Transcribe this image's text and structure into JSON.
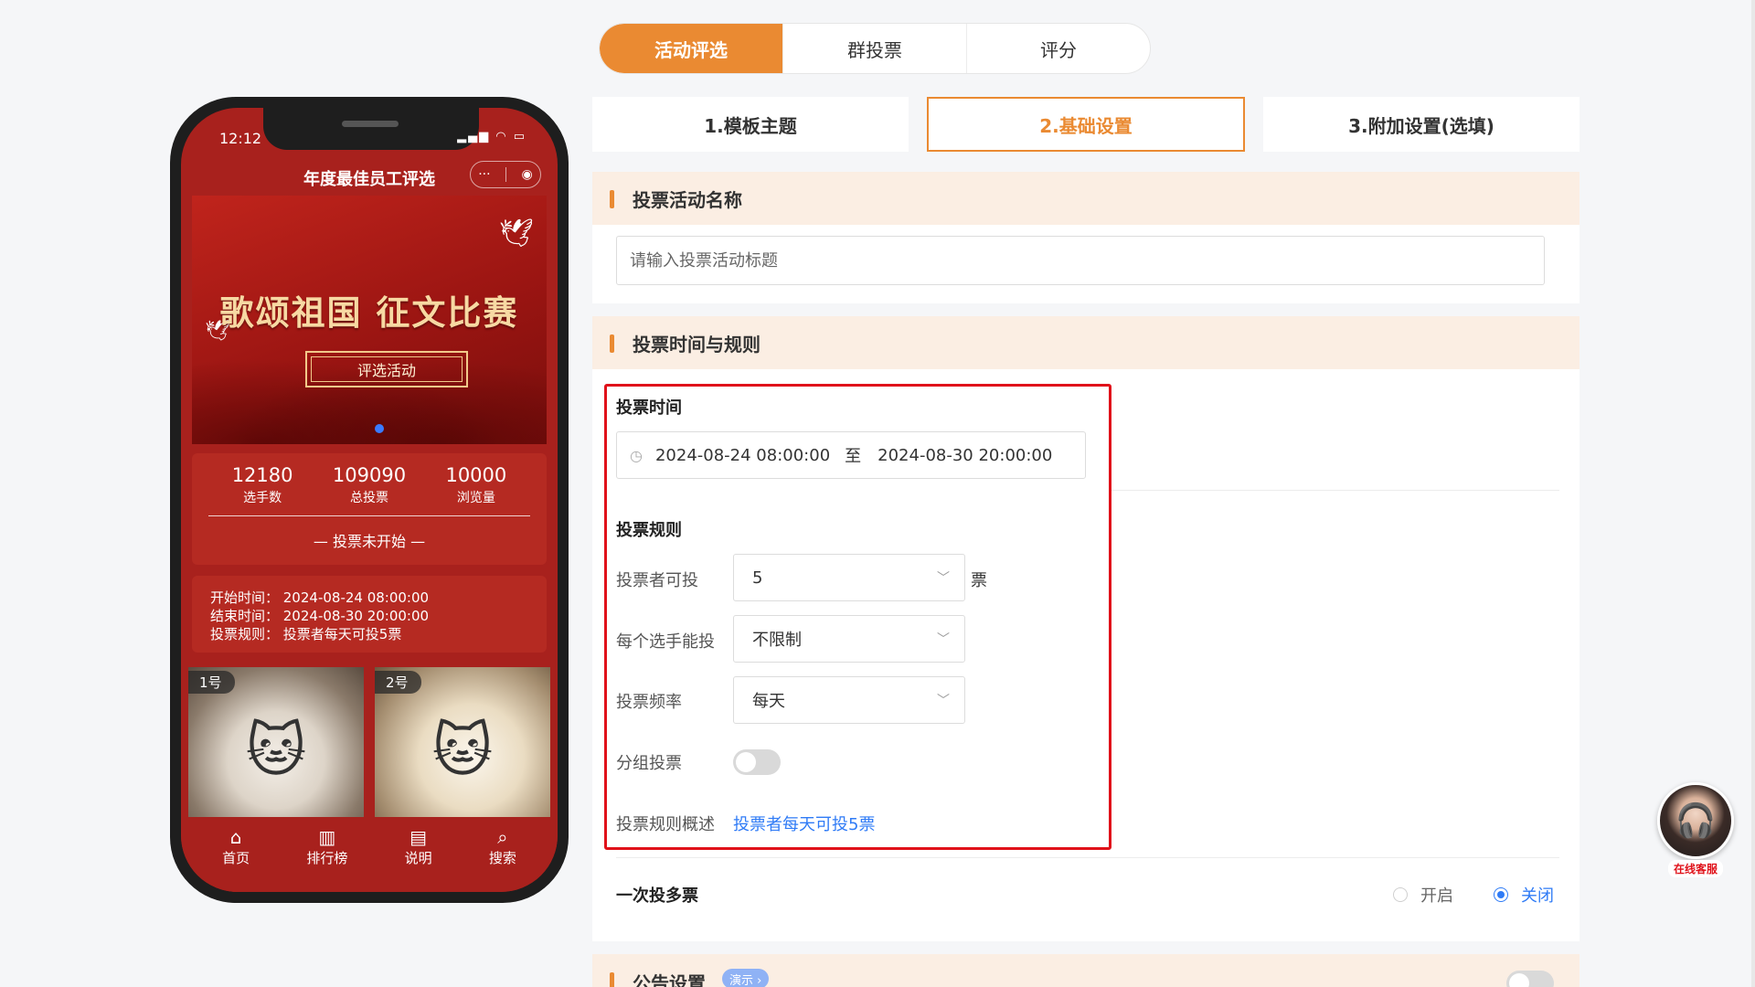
{
  "mode_tabs": [
    "活动评选",
    "群投票",
    "评分"
  ],
  "phone": {
    "status_time": "12:12",
    "status_icons": "▂▄▆ ◠ ▭",
    "page_title": "年度最佳员工评选",
    "capsule_more": "···",
    "capsule_close": "◉",
    "banner_title": "歌颂祖国 征文比赛",
    "banner_button": "评选活动",
    "stats": [
      {
        "value": "12180",
        "label": "选手数"
      },
      {
        "value": "109090",
        "label": "总投票"
      },
      {
        "value": "10000",
        "label": "浏览量"
      }
    ],
    "vote_status": "— 投票未开始 —",
    "info_lines": [
      "开始时间： 2024-08-24 08:00:00",
      "结束时间： 2024-08-30 20:00:00",
      "投票规则： 投票者每天可投5票"
    ],
    "contestants": [
      {
        "tag": "1号",
        "icon": "cat-photo"
      },
      {
        "tag": "2号",
        "icon": "cat-photo"
      }
    ],
    "tabbar": [
      {
        "icon": "home-icon",
        "glyph": "⌂",
        "label": "首页"
      },
      {
        "icon": "ranking-icon",
        "glyph": "▥",
        "label": "排行榜"
      },
      {
        "icon": "document-icon",
        "glyph": "▤",
        "label": "说明"
      },
      {
        "icon": "search-icon",
        "glyph": "⌕",
        "label": "搜索"
      }
    ]
  },
  "steps": [
    "1.模板主题",
    "2.基础设置",
    "3.附加设置(选填)"
  ],
  "section_name": {
    "title": "投票活动名称",
    "input_placeholder": "请输入投票活动标题",
    "input_value": ""
  },
  "section_time": {
    "title": "投票时间与规则",
    "time_label": "投票时间",
    "start": "2024-08-24 08:00:00",
    "to": "至",
    "end": "2024-08-30 20:00:00",
    "rules_label": "投票规则",
    "votes_per_voter_label": "投票者可投",
    "votes_per_voter_value": "5",
    "votes_unit": "票",
    "per_contestant_label": "每个选手能投",
    "per_contestant_value": "不限制",
    "frequency_label": "投票频率",
    "frequency_value": "每天",
    "group_vote_label": "分组投票",
    "group_vote_on": false,
    "summary_label": "投票规则概述",
    "summary_value": "投票者每天可投5票"
  },
  "multi_vote": {
    "label": "一次投多票",
    "option_on": "开启",
    "option_off": "关闭",
    "selected": "关闭"
  },
  "announcement": {
    "title": "公告设置",
    "badge": "演示 ›",
    "enabled": false
  },
  "customer_service": {
    "label": "在线客服"
  },
  "colors": {
    "accent": "#ea8a32",
    "highlight_border": "#e0121a",
    "link": "#2f7bf6",
    "phone_bg": "#a8211d"
  }
}
